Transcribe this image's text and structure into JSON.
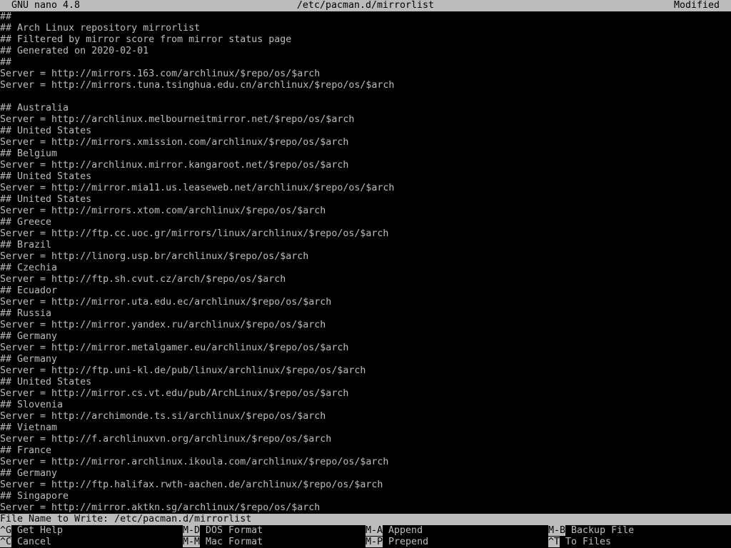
{
  "titlebar": {
    "app_name": "GNU nano 4.8",
    "file_path": "/etc/pacman.d/mirrorlist",
    "status": "Modified"
  },
  "editor": {
    "lines": [
      "##",
      "## Arch Linux repository mirrorlist",
      "## Filtered by mirror score from mirror status page",
      "## Generated on 2020-02-01",
      "##",
      "Server = http://mirrors.163.com/archlinux/$repo/os/$arch",
      "Server = http://mirrors.tuna.tsinghua.edu.cn/archlinux/$repo/os/$arch",
      "",
      "## Australia",
      "Server = http://archlinux.melbourneitmirror.net/$repo/os/$arch",
      "## United States",
      "Server = http://mirrors.xmission.com/archlinux/$repo/os/$arch",
      "## Belgium",
      "Server = http://archlinux.mirror.kangaroot.net/$repo/os/$arch",
      "## United States",
      "Server = http://mirror.mia11.us.leaseweb.net/archlinux/$repo/os/$arch",
      "## United States",
      "Server = http://mirrors.xtom.com/archlinux/$repo/os/$arch",
      "## Greece",
      "Server = http://ftp.cc.uoc.gr/mirrors/linux/archlinux/$repo/os/$arch",
      "## Brazil",
      "Server = http://linorg.usp.br/archlinux/$repo/os/$arch",
      "## Czechia",
      "Server = http://ftp.sh.cvut.cz/arch/$repo/os/$arch",
      "## Ecuador",
      "Server = http://mirror.uta.edu.ec/archlinux/$repo/os/$arch",
      "## Russia",
      "Server = http://mirror.yandex.ru/archlinux/$repo/os/$arch",
      "## Germany",
      "Server = http://mirror.metalgamer.eu/archlinux/$repo/os/$arch",
      "## Germany",
      "Server = http://ftp.uni-kl.de/pub/linux/archlinux/$repo/os/$arch",
      "## United States",
      "Server = http://mirror.cs.vt.edu/pub/ArchLinux/$repo/os/$arch",
      "## Slovenia",
      "Server = http://archimonde.ts.si/archlinux/$repo/os/$arch",
      "## Vietnam",
      "Server = http://f.archlinuxvn.org/archlinux/$repo/os/$arch",
      "## France",
      "Server = http://mirror.archlinux.ikoula.com/archlinux/$repo/os/$arch",
      "## Germany",
      "Server = http://ftp.halifax.rwth-aachen.de/archlinux/$repo/os/$arch",
      "## Singapore",
      "Server = http://mirror.aktkn.sg/archlinux/$repo/os/$arch"
    ]
  },
  "prompt": {
    "label": "File Name to Write: ",
    "value": "/etc/pacman.d/mirrorlist"
  },
  "shortcuts": [
    {
      "key": "^G",
      "label": " Get Help"
    },
    {
      "key": "M-D",
      "label": " DOS Format"
    },
    {
      "key": "M-A",
      "label": " Append"
    },
    {
      "key": "M-B",
      "label": " Backup File"
    },
    {
      "key": "^C",
      "label": " Cancel"
    },
    {
      "key": "M-M",
      "label": " Mac Format"
    },
    {
      "key": "M-P",
      "label": " Prepend"
    },
    {
      "key": "^T",
      "label": " To Files"
    }
  ],
  "colors": {
    "background": "#000000",
    "foreground": "#bcbcbc",
    "inverse_bg": "#bcbcbc",
    "inverse_fg": "#000000"
  }
}
